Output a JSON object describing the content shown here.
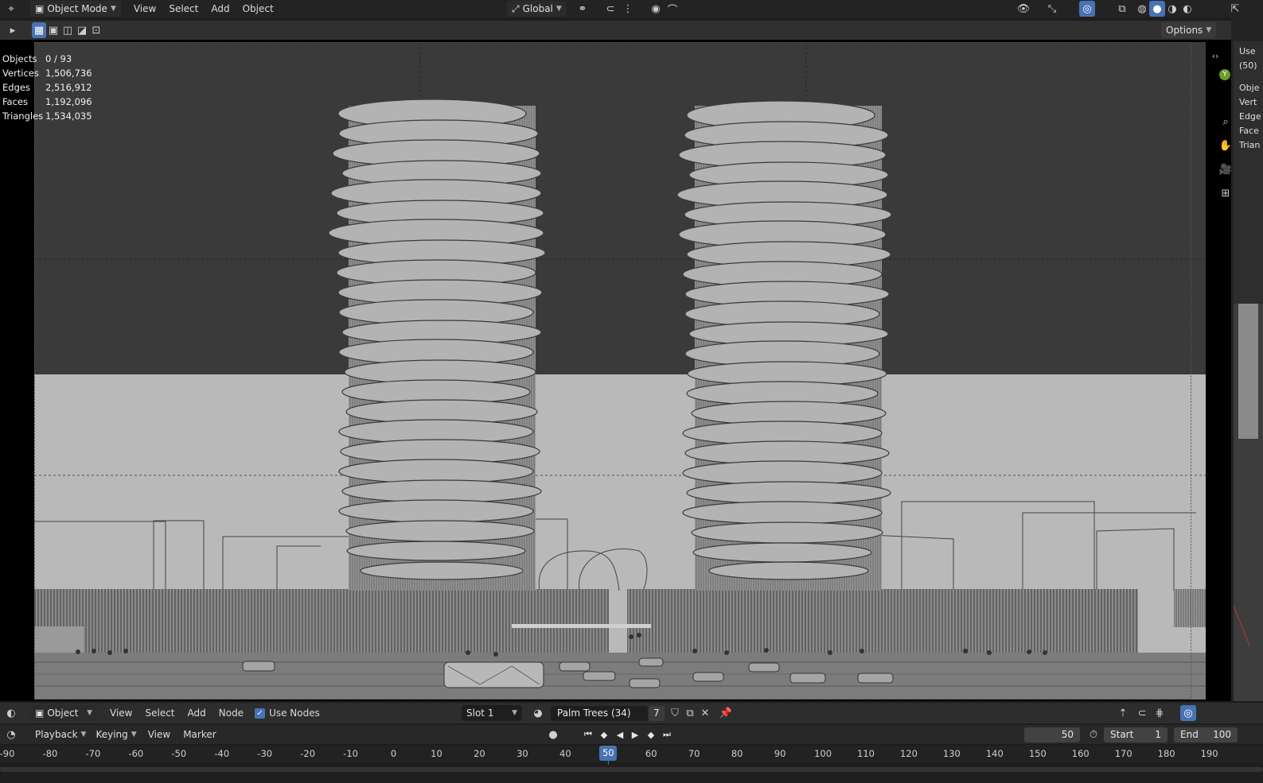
{
  "header": {
    "editor_type_icon": "3d-viewport-icon",
    "mode_label": "Object Mode",
    "menus": [
      "View",
      "Select",
      "Add",
      "Object"
    ],
    "transform_orientation": "Global",
    "options_label": "Options"
  },
  "stats": [
    {
      "label": "Objects",
      "value": "0 / 93"
    },
    {
      "label": "Vertices",
      "value": "1,506,736"
    },
    {
      "label": "Edges",
      "value": "2,516,912"
    },
    {
      "label": "Faces",
      "value": "1,192,096"
    },
    {
      "label": "Triangles",
      "value": "1,534,035"
    }
  ],
  "right_panel_partial": [
    "Use",
    "(50)",
    "Obje",
    "Vert",
    "Edge",
    "Face",
    "Trian"
  ],
  "node_editor": {
    "editor_type": "Object",
    "menus": [
      "View",
      "Select",
      "Add",
      "Node"
    ],
    "use_nodes_label": "Use Nodes",
    "slot": "Slot 1",
    "material_name": "Palm Trees (34)",
    "user_count": "7"
  },
  "timeline": {
    "menus": [
      "Playback",
      "Keying",
      "View",
      "Marker"
    ],
    "current_frame": "50",
    "start_label": "Start",
    "start_value": "1",
    "end_label": "End",
    "end_value": "100",
    "ruler_ticks": [
      "-90",
      "-80",
      "-70",
      "-60",
      "-50",
      "-40",
      "-30",
      "-20",
      "-10",
      "0",
      "10",
      "20",
      "30",
      "40",
      "50",
      "60",
      "70",
      "80",
      "90",
      "100",
      "110",
      "120",
      "130",
      "140",
      "150",
      "160",
      "170",
      "180",
      "190"
    ],
    "playhead_label": "50"
  },
  "colors": {
    "accent": "#4772b3",
    "sky": "#3a3a3a",
    "ground": "#b9b9b9"
  }
}
